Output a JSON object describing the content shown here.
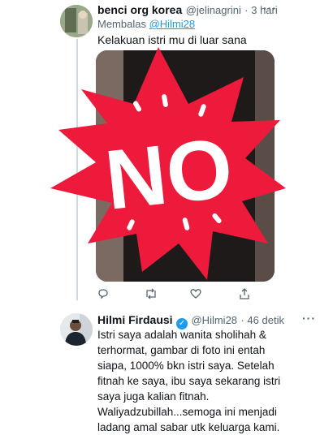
{
  "reply_tweet": {
    "display_name": "benci org korea",
    "handle": "@jelinagrini",
    "time": "· 3 hari",
    "more_label": "···",
    "replying_prefix": "Membalas",
    "replying_to": "@Hilmi28",
    "text": "Kelakuan istri mu di luar sana"
  },
  "actions": [
    {
      "icon": "reply-icon",
      "count": ""
    },
    {
      "icon": "retweet-icon",
      "count": ""
    },
    {
      "icon": "like-icon",
      "count": ""
    },
    {
      "icon": "share-icon",
      "count": ""
    }
  ],
  "stamp": {
    "text": "NO",
    "color": "#ee1a3b"
  },
  "main_tweet": {
    "display_name": "Hilmi Firdausi",
    "handle": "@Hilmi28",
    "time": "· 46 detik",
    "more_label": "···",
    "lines": [
      "Istri saya adalah wanita sholihah &",
      "terhormat, gambar di foto ini entah",
      "siapa, 1000% bkn istri saya. Setelah",
      "fitnah ke saya, ibu saya sekarang istri",
      "saya juga kalian fitnah.",
      "Waliyadzubillah...semoga ini menjadi",
      "ladang amal sabar utk keluarga kami."
    ]
  },
  "colors": {
    "accent": "#1d9bf0",
    "secondary_text": "#536471"
  }
}
